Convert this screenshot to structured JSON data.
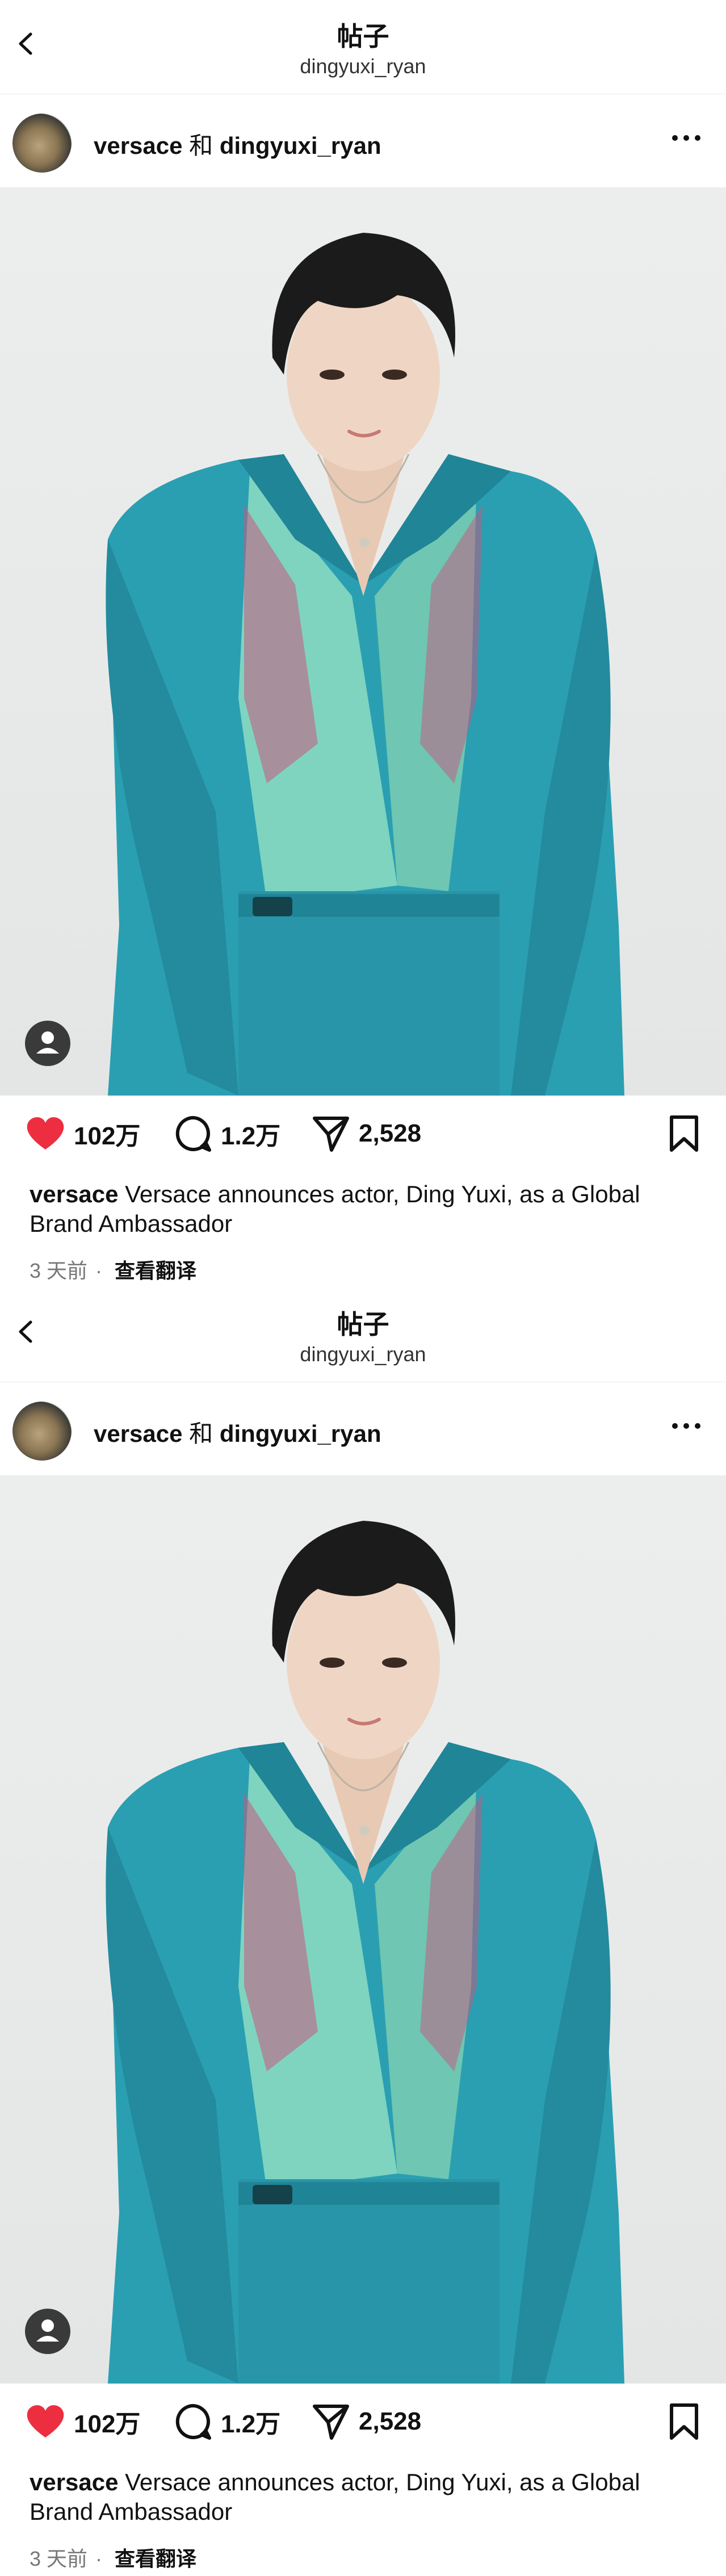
{
  "posts": [
    {
      "header": {
        "title": "帖子",
        "subtitle": "dingyuxi_ryan"
      },
      "author": {
        "brand": "versace",
        "joiner": "和",
        "collaborator": "dingyuxi_ryan"
      },
      "stats": {
        "likes": "102万",
        "comments": "1.2万",
        "shares": "2,528"
      },
      "caption": {
        "username": "versace",
        "text": "Versace announces actor, Ding Yuxi, as a Global Brand Ambassador"
      },
      "meta": {
        "time": "3 天前",
        "separator": "·",
        "translate": "查看翻译"
      }
    },
    {
      "header": {
        "title": "帖子",
        "subtitle": "dingyuxi_ryan"
      },
      "author": {
        "brand": "versace",
        "joiner": "和",
        "collaborator": "dingyuxi_ryan"
      },
      "stats": {
        "likes": "102万",
        "comments": "1.2万",
        "shares": "2,528"
      },
      "caption": {
        "username": "versace",
        "text": "Versace announces actor, Ding Yuxi, as a Global Brand Ambassador"
      },
      "meta": {
        "time": "3 天前",
        "separator": "·",
        "translate": "查看翻译"
      }
    }
  ],
  "colors": {
    "like_red": "#ed2e40",
    "suit_teal": "#2a9fb2",
    "shirt_mint": "#7fd4bf",
    "hair": "#1b1b1b"
  },
  "icons": [
    "back-chevron-icon",
    "more-dots-icon",
    "heart-icon",
    "comment-icon",
    "share-icon",
    "bookmark-icon",
    "user-tag-icon"
  ]
}
